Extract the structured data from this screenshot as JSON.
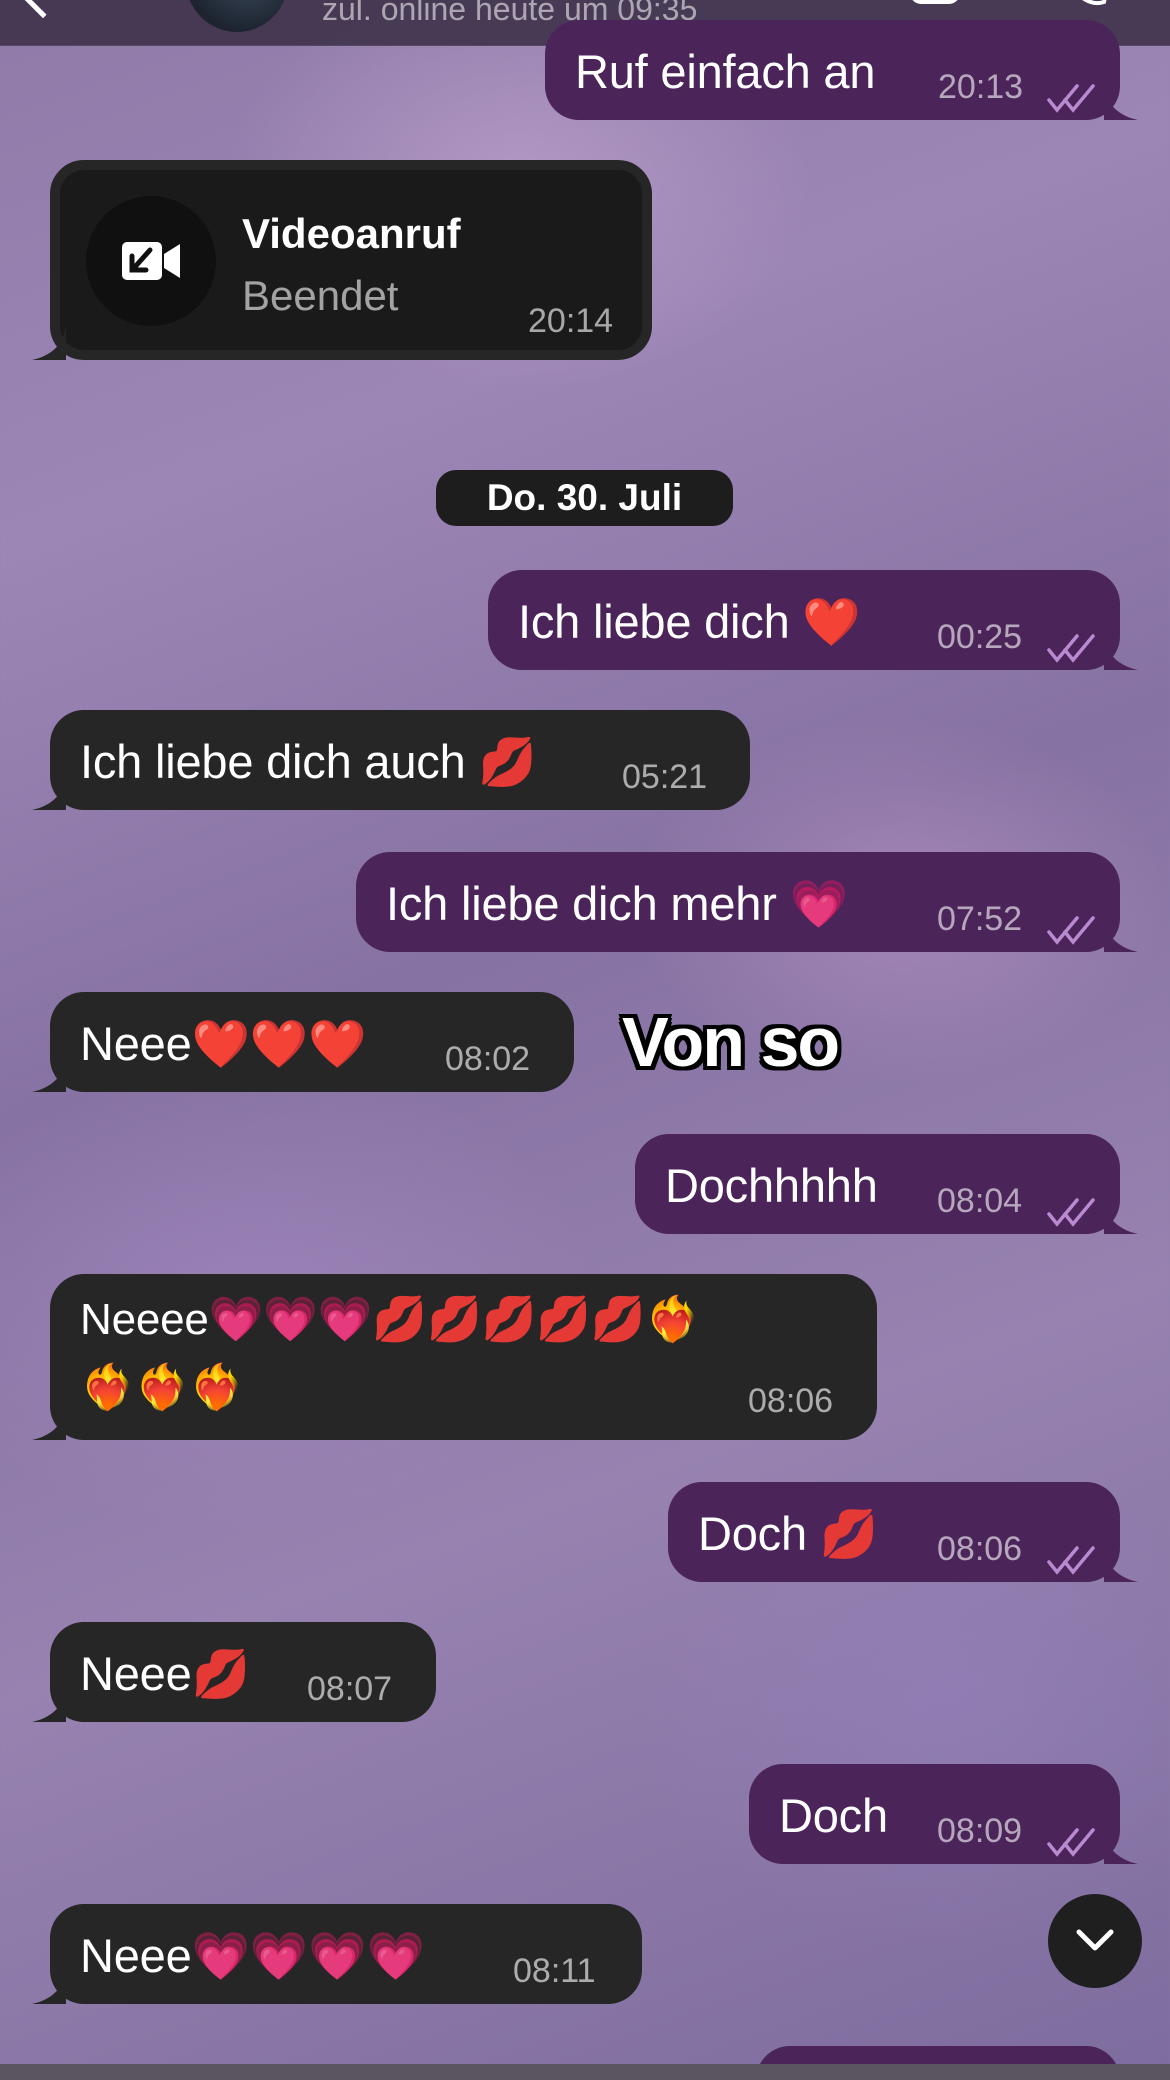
{
  "header": {
    "status": "zul. online heute um 09:35"
  },
  "video_call": {
    "title": "Videoanruf",
    "subtitle": "Beendet",
    "time": "20:14"
  },
  "date_separator": "Do. 30. Juli",
  "overlay_caption": "Von so",
  "colors": {
    "outgoing_bubble": "#4b2459",
    "incoming_bubble": "#262626",
    "read_ticks": "#b98ad0"
  },
  "messages": [
    {
      "direction": "outgoing",
      "text": "Ruf einfach an",
      "time": "20:13",
      "read": true
    },
    {
      "direction": "outgoing",
      "text": "Ich liebe dich ❤️",
      "time": "00:25",
      "read": true
    },
    {
      "direction": "incoming",
      "text": "Ich liebe dich auch 💋",
      "time": "05:21"
    },
    {
      "direction": "outgoing",
      "text": "Ich liebe dich mehr 💗",
      "time": "07:52",
      "read": true
    },
    {
      "direction": "incoming",
      "text": "Neee❤️❤️❤️",
      "time": "08:02"
    },
    {
      "direction": "outgoing",
      "text": "Dochhhhh",
      "time": "08:04",
      "read": true
    },
    {
      "direction": "incoming",
      "text_line1": "Neeee💗💗💗💋💋💋💋💋❤️‍🔥",
      "text_line2": "❤️‍🔥❤️‍🔥❤️‍🔥",
      "time": "08:06"
    },
    {
      "direction": "outgoing",
      "text": "Doch 💋",
      "time": "08:06",
      "read": true
    },
    {
      "direction": "incoming",
      "text": "Neee💋",
      "time": "08:07"
    },
    {
      "direction": "outgoing",
      "text": "Doch",
      "time": "08:09",
      "read": true
    },
    {
      "direction": "incoming",
      "text": "Neee💗💗💗💗",
      "time": "08:11"
    }
  ],
  "icons": {
    "back": "chevron-left-icon",
    "video_call": "video-camera-icon",
    "phone": "phone-icon",
    "missed_call": "video-call-incoming-icon",
    "scroll_down": "chevron-down-icon",
    "read_receipt": "double-check-icon"
  }
}
